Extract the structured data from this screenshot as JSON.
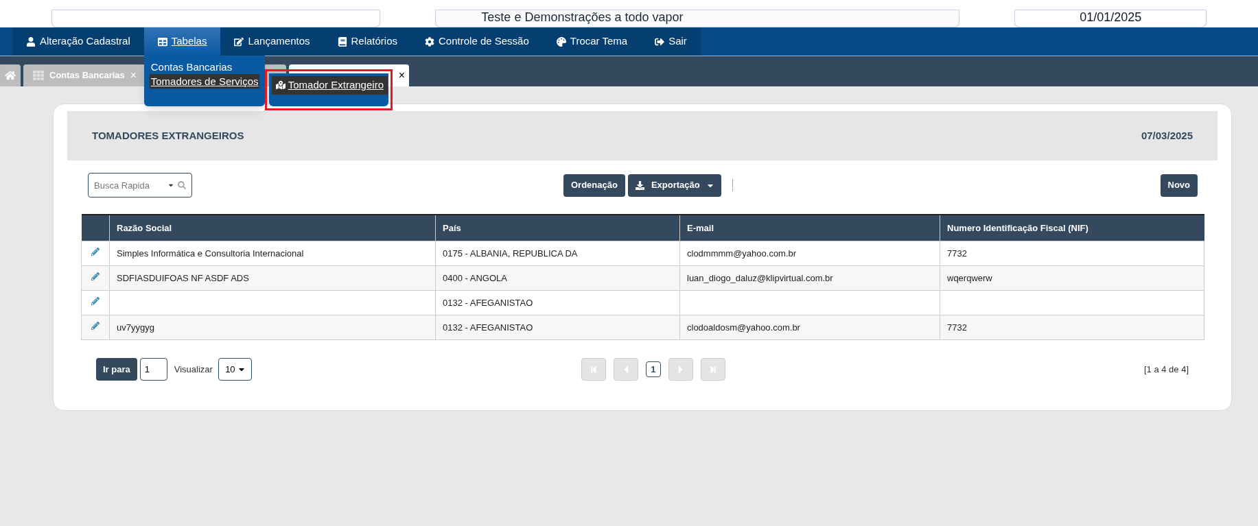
{
  "top_bar": {
    "notice": "Teste e Demonstrações a todo vapor",
    "date": "01/01/2025"
  },
  "nav": {
    "items": [
      {
        "label": "Alteração Cadastral",
        "selected": false
      },
      {
        "label": "Tabelas",
        "selected": true
      },
      {
        "label": "Lançamentos",
        "selected": false
      },
      {
        "label": "Relatórios",
        "selected": false
      },
      {
        "label": "Controle de Sessão",
        "selected": false
      },
      {
        "label": "Trocar Tema",
        "selected": false
      },
      {
        "label": "Sair",
        "selected": false
      }
    ]
  },
  "menu": {
    "items": [
      {
        "label": "Contas Bancarias",
        "selected": false
      },
      {
        "label": "Tomadores de Serviços",
        "selected": true
      }
    ],
    "submenu": {
      "label": "Tomador Extrangeiro",
      "highlighted": true
    }
  },
  "tabs": [
    {
      "label": "Contas Bancarias",
      "close": "×",
      "selected": false
    }
  ],
  "active_tab": {
    "close": "×"
  },
  "panel": {
    "title": "TOMADORES EXTRANGEIROS",
    "date": "07/03/2025",
    "search": {
      "placeholder": "Busca Rapida"
    },
    "buttons": {
      "sort": "Ordenação",
      "export": "Exportação",
      "new": "Novo"
    },
    "table": {
      "columns": [
        "Razão Social",
        "País",
        "E-mail",
        "Numero Identificação Fiscal (NIF)"
      ],
      "rows": [
        [
          "Simples Informática e Consultoria Internacional",
          "0175 - ALBANIA, REPUBLICA DA",
          "clodmmmm@yahoo.com.br",
          "7732"
        ],
        [
          "SDFIASDUIFOAS NF ASDF ADS",
          "0400 - ANGOLA",
          "luan_diogo_daluz@klipvirtual.com.br",
          "wqerqwerw"
        ],
        [
          "",
          "0132 - AFEGANISTAO",
          "",
          ""
        ],
        [
          "uv7yygyg",
          "0132 - AFEGANISTAO",
          "clodoaldosm@yahoo.com.br",
          "7732"
        ]
      ]
    },
    "pagination": {
      "goto_label": "Ir para",
      "goto_value": "1",
      "view_label": "Visualizar",
      "page_size": "10",
      "current_page": "1",
      "summary": "[1 a 4 de 4]"
    }
  }
}
